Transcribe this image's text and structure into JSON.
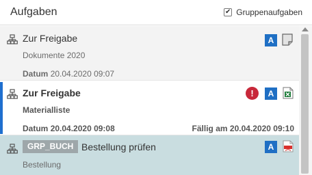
{
  "header": {
    "title": "Aufgaben",
    "group_label": "Gruppenaufgaben",
    "group_checked": "✔"
  },
  "tasks": [
    {
      "title": "Zur Freigabe",
      "subtitle": "Dokumente 2020",
      "date_label": "Datum",
      "date_value": "20.04.2020 09:07",
      "badge": "A",
      "file_icon": "generic-document-icon"
    },
    {
      "title": "Zur Freigabe",
      "subtitle": "Materialliste",
      "date_label": "Datum",
      "date_value": "20.04.2020 09:08",
      "due_label": "Fällig am",
      "due_value": "20.04.2020 09:10",
      "alert": "!",
      "badge": "A",
      "file_icon": "excel-file-icon"
    },
    {
      "group_tag": "GRP_BUCH",
      "title": "Bestellung prüfen",
      "subtitle": "Bestellung",
      "badge": "A",
      "file_icon": "pdf-file-icon"
    }
  ],
  "colors": {
    "accent": "#1f6fcf",
    "badge_blue": "#1f6fc4",
    "alert_red": "#c8283a",
    "selected_row": "#c9dde0",
    "group_tag": "#9ea7aa"
  }
}
